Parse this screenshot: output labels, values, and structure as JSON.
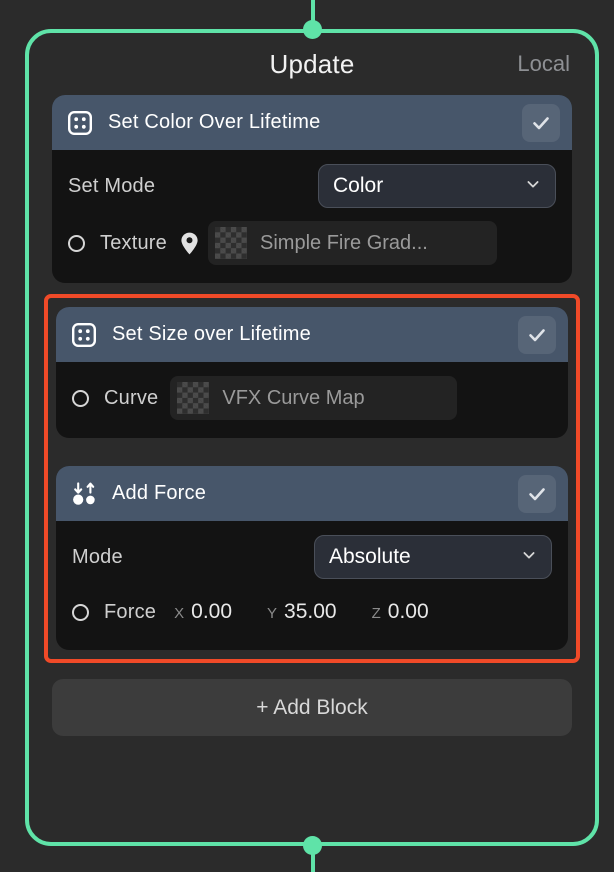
{
  "node": {
    "title": "Update",
    "space_label": "Local",
    "accent_color": "#5fe3a8",
    "selection_color": "#f04a28",
    "header_color": "#47566a"
  },
  "ports": {
    "top_icon": "input-port-dot",
    "bottom_icon": "output-port-dot"
  },
  "blocks": [
    {
      "icon": "dice-four-icon",
      "title": "Set Color Over Lifetime",
      "enabled_icon": "check-icon",
      "selected": false,
      "rows": [
        {
          "type": "dropdown",
          "label": "Set Mode",
          "value": "Color",
          "chevron_icon": "chevron-down-icon"
        },
        {
          "type": "asset",
          "label": "Texture",
          "socket_icon": "socket-circle-icon",
          "pin_icon": "location-pin-icon",
          "thumb_icon": "checkerboard-thumbnail",
          "value": "Simple Fire Grad..."
        }
      ]
    },
    {
      "icon": "dice-four-icon",
      "title": "Set Size over Lifetime",
      "enabled_icon": "check-icon",
      "selected": true,
      "rows": [
        {
          "type": "asset",
          "label": "Curve",
          "socket_icon": "socket-circle-icon",
          "thumb_icon": "checkerboard-thumbnail",
          "value": "VFX Curve Map"
        }
      ]
    },
    {
      "icon": "add-force-icon",
      "title": "Add Force",
      "enabled_icon": "check-icon",
      "selected": true,
      "rows": [
        {
          "type": "dropdown",
          "label": "Mode",
          "value": "Absolute",
          "chevron_icon": "chevron-down-icon"
        },
        {
          "type": "vector",
          "label": "Force",
          "socket_icon": "socket-circle-icon",
          "axes": [
            "X",
            "Y",
            "Z"
          ],
          "values": [
            "0.00",
            "35.00",
            "0.00"
          ]
        }
      ]
    }
  ],
  "add_block": {
    "label": "+ Add Block"
  }
}
